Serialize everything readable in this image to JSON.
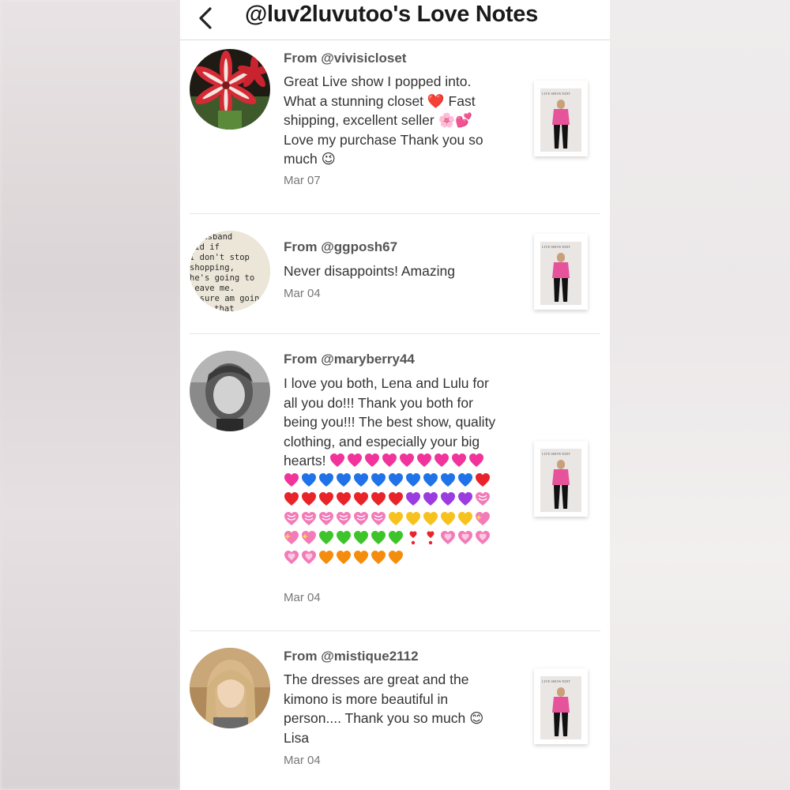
{
  "header": {
    "title": "@luv2luvutoo's Love Notes"
  },
  "notes": [
    {
      "from": "From @vivisicloset",
      "message": "Great Live show I popped into. What a stunning closet ❤️ Fast shipping, excellent seller 🌸💕 Love my purchase Thank you so much 😉",
      "date": "Mar 07"
    },
    {
      "from": "From @ggposh67",
      "message": "Never disappoints! Amazing",
      "date": "Mar 04",
      "avatar_text": "husband said if I don't stop shopping, he's going to leave me. sure am goin miss that"
    },
    {
      "from": "From @maryberry44",
      "message": "I love you both, Lena and Lulu for all you do!!! Thank you both for being you!!! The best show, quality clothing, and especially your big hearts!",
      "date": "Mar 04",
      "hearts": [
        "pink",
        "pink",
        "pink",
        "pink",
        "pink",
        "pink",
        "pink",
        "pink",
        "pink",
        "pink",
        "blue",
        "blue",
        "blue",
        "blue",
        "blue",
        "blue",
        "blue",
        "blue",
        "blue",
        "blue",
        "red",
        "red",
        "red",
        "red",
        "red",
        "red",
        "red",
        "red",
        "purple",
        "purple",
        "purple",
        "purple",
        "pinkstripe",
        "pinkstripe",
        "pinkstripe",
        "pinkstripe",
        "pinkstripe",
        "pinkstripe",
        "pinkstripe",
        "yellow",
        "yellow",
        "yellow",
        "yellow",
        "yellow",
        "sparkle",
        "sparkle",
        "sparkle",
        "green",
        "green",
        "green",
        "green",
        "green",
        "exclaim",
        "exclaim",
        "pinkgrow",
        "pinkgrow",
        "pinkgrow",
        "pinkgrow",
        "pinkgrow",
        "orange",
        "orange",
        "orange",
        "orange",
        "orange"
      ]
    },
    {
      "from": "From @mistique2112",
      "message": "The dresses are great and the kimono is more beautiful in person.... Thank you so much 😊 Lisa",
      "date": "Mar 04"
    }
  ],
  "thumbnail": {
    "label": "LIVE SHOW EDIT"
  },
  "icons": {
    "back": "chevron-left-icon",
    "heart": "heart-icon"
  },
  "colors": {
    "pink": "#f0349b",
    "blue": "#1f72e8",
    "red": "#e8232a",
    "purple": "#9b3be0",
    "yellow": "#f7c21e",
    "green": "#3ec42b",
    "orange": "#f48d0d",
    "pinkstripe": "#f27bb8"
  }
}
